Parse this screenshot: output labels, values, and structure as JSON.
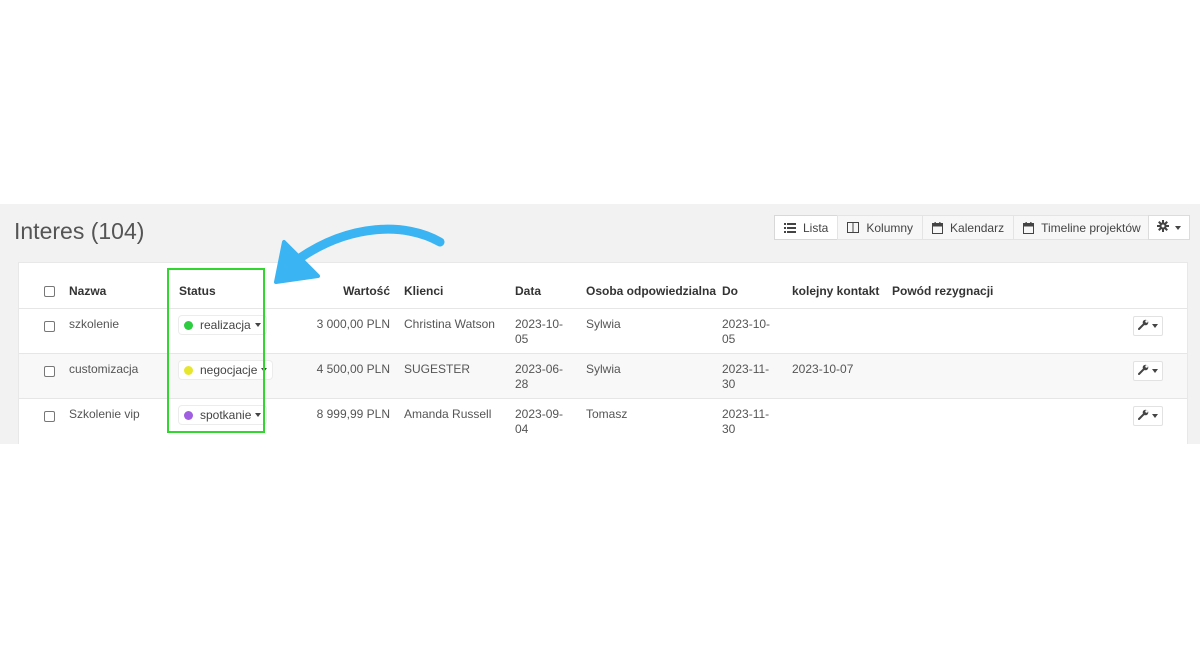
{
  "header": {
    "title": "Interes (104)"
  },
  "view_switch": [
    {
      "label": "Lista",
      "icon": "list-icon",
      "active": true
    },
    {
      "label": "Kolumny",
      "icon": "columns-icon",
      "active": false
    },
    {
      "label": "Kalendarz",
      "icon": "calendar-icon",
      "active": false
    },
    {
      "label": "Timeline projektów",
      "icon": "calendar-icon",
      "active": false
    }
  ],
  "settings": {
    "icon": "gear-icon"
  },
  "table": {
    "columns": {
      "name": "Nazwa",
      "status": "Status",
      "value": "Wartość",
      "clients": "Klienci",
      "date": "Data",
      "owner": "Osoba odpowiedzialna",
      "due": "Do",
      "next_contact": "kolejny kontakt",
      "reason": "Powód rezygnacji"
    },
    "rows": [
      {
        "name": "szkolenie",
        "status": "realizacja",
        "status_color": "#2ecc40",
        "value": "3 000,00 PLN",
        "client": "Christina Watson",
        "date_l1": "2023-10-",
        "date_l2": "05",
        "owner": "Sylwia",
        "due_l1": "2023-10-",
        "due_l2": "05",
        "next_contact": "",
        "reason": ""
      },
      {
        "name": "customizacja",
        "status": "negocjacje",
        "status_color": "#e6e62e",
        "value": "4 500,00 PLN",
        "client": "SUGESTER",
        "date_l1": "2023-06-",
        "date_l2": "28",
        "owner": "Sylwia",
        "due_l1": "2023-11-",
        "due_l2": "30",
        "next_contact": "2023-10-07",
        "reason": ""
      },
      {
        "name": "Szkolenie vip",
        "status": "spotkanie",
        "status_color": "#a05fe0",
        "value": "8 999,99 PLN",
        "client": "Amanda Russell",
        "date_l1": "2023-09-",
        "date_l2": "04",
        "owner": "Tomasz",
        "due_l1": "2023-11-",
        "due_l2": "30",
        "next_contact": "",
        "reason": ""
      }
    ]
  },
  "annotation": {
    "highlight_color": "#33d62f",
    "arrow_color": "#3ab4f2"
  }
}
